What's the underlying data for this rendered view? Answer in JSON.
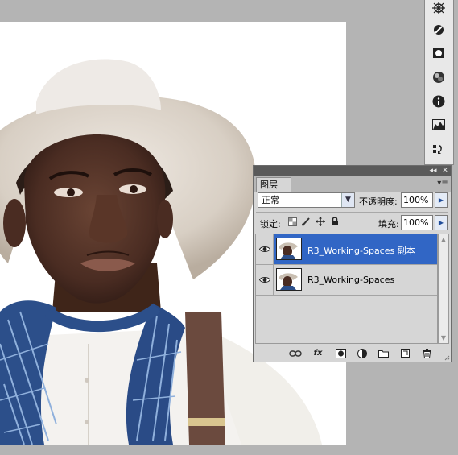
{
  "canvas": {
    "description_icon": "photo-canvas"
  },
  "toolstrip": {
    "tools": [
      {
        "icon": "navigator-icon"
      },
      {
        "icon": "color-icon"
      },
      {
        "icon": "swatches-icon"
      },
      {
        "icon": "styles-icon"
      },
      {
        "icon": "info-icon"
      },
      {
        "icon": "histogram-icon"
      },
      {
        "icon": "history-icon"
      }
    ]
  },
  "layers_panel": {
    "tab_label": "图层",
    "collapse_glyph": "◂◂",
    "close_glyph": "✕",
    "menu_glyph": "▾≡",
    "blend_mode": "正常",
    "opacity_label": "不透明度:",
    "opacity_value": "100%",
    "lock_label": "锁定:",
    "fill_label": "填充:",
    "fill_value": "100%",
    "layers": [
      {
        "name": "R3_Working-Spaces 副本",
        "selected": true,
        "visible": true
      },
      {
        "name": "R3_Working-Spaces",
        "selected": false,
        "visible": true
      }
    ],
    "bottom_icons": [
      "link-icon",
      "fx-icon",
      "mask-icon",
      "adjustment-icon",
      "group-icon",
      "new-layer-icon",
      "trash-icon"
    ],
    "fx_label": "fx"
  },
  "colors": {
    "selected_row": "#3166c5",
    "panel_bg": "#d6d6d6",
    "workspace_bg": "#b4b4b4"
  }
}
